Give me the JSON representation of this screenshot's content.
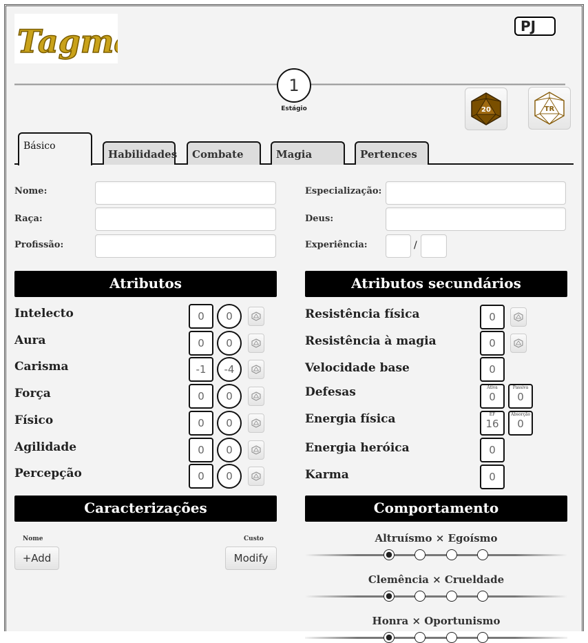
{
  "header": {
    "logo_text": "Tagmar",
    "badge": "PJ",
    "stage_value": "1",
    "stage_label": "Estágio",
    "d20_label": "20",
    "tr_label": "TR"
  },
  "tabs": [
    {
      "label": "Básico",
      "active": true
    },
    {
      "label": "Habilidades"
    },
    {
      "label": "Combate"
    },
    {
      "label": "Magia"
    },
    {
      "label": "Pertences"
    }
  ],
  "fields": {
    "nome": "Nome:",
    "raca": "Raça:",
    "profissao": "Profissão:",
    "especializacao": "Especialização:",
    "deus": "Deus:",
    "experiencia": "Experiência:",
    "exp_sep": "/"
  },
  "atributos": {
    "title": "Atributos",
    "items": [
      {
        "name": "Intelecto",
        "value": "0",
        "mod": "0"
      },
      {
        "name": "Aura",
        "value": "0",
        "mod": "0"
      },
      {
        "name": "Carisma",
        "value": "-1",
        "mod": "-4"
      },
      {
        "name": "Força",
        "value": "0",
        "mod": "0"
      },
      {
        "name": "Físico",
        "value": "0",
        "mod": "0"
      },
      {
        "name": "Agilidade",
        "value": "0",
        "mod": "0"
      },
      {
        "name": "Percepção",
        "value": "0",
        "mod": "0"
      }
    ]
  },
  "secundarios": {
    "title": "Atributos secundários",
    "resistencia_fisica": {
      "label": "Resistência física",
      "value": "0"
    },
    "resistencia_magia": {
      "label": "Resistência à magia",
      "value": "0"
    },
    "velocidade": {
      "label": "Velocidade base",
      "value": "0"
    },
    "defesas": {
      "label": "Defesas",
      "ativa_cap": "Ativa",
      "ativa": "0",
      "passiva_cap": "Passiva",
      "passiva": "0"
    },
    "energia_fisica": {
      "label": "Energia física",
      "ef_cap": "EF",
      "ef": "16",
      "abs_cap": "Absorção",
      "abs": "0"
    },
    "energia_heroica": {
      "label": "Energia heróica",
      "value": "0"
    },
    "karma": {
      "label": "Karma",
      "value": "0"
    }
  },
  "caracterizacoes": {
    "title": "Caracterizações",
    "nome_label": "Nome",
    "custo_label": "Custo",
    "add_button": "+Add",
    "modify_button": "Modify"
  },
  "comportamento": {
    "title": "Comportamento",
    "scales": [
      {
        "label": "Altruísmo × Egoísmo",
        "selected": 0
      },
      {
        "label": "Clemência × Crueldade",
        "selected": 0
      },
      {
        "label": "Honra × Oportunismo",
        "selected": 0
      }
    ]
  }
}
